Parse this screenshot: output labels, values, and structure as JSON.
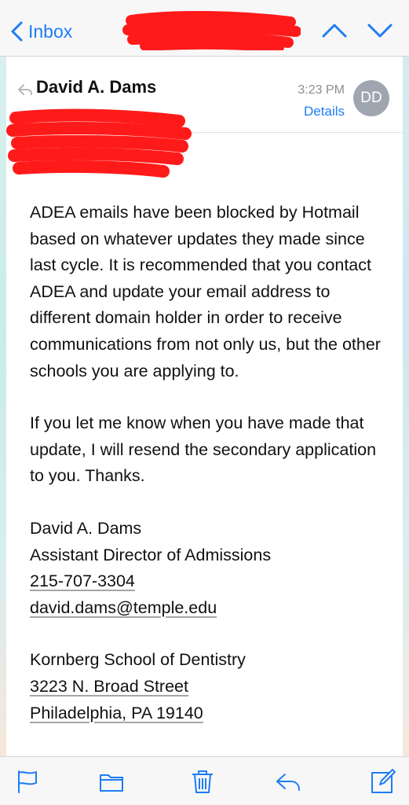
{
  "nav": {
    "back_label": "Inbox",
    "icons": [
      "chevron-left-icon",
      "chevron-up-icon",
      "chevron-down-icon"
    ]
  },
  "message": {
    "sender": "David A. Dams",
    "time": "3:23 PM",
    "details_label": "Details",
    "avatar_initials": "DD",
    "body": {
      "paragraph1": "ADEA emails have been blocked by Hotmail based on whatever updates they made since last cycle.  It is recommended that you contact ADEA and update your email address to different domain holder in order to receive communications from not only us, but the other schools you are applying to.",
      "paragraph2": "If you let me know when you have made that update, I will resend the secondary application to you.  Thanks.",
      "signature": {
        "name": "David A. Dams",
        "title": "Assistant Director of Admissions",
        "phone": "215-707-3304",
        "email": "david.dams@temple.edu",
        "school": "Kornberg School of Dentistry",
        "street": "3223 N. Broad Street",
        "city": "Philadelphia, PA 19140"
      }
    }
  },
  "toolbar": {
    "icons": [
      "flag-icon",
      "folder-icon",
      "trash-icon",
      "reply-icon",
      "compose-icon"
    ]
  },
  "colors": {
    "accent": "#1e7cf5",
    "redaction": "#ff1a1a",
    "avatar": "#a0a6b0"
  }
}
